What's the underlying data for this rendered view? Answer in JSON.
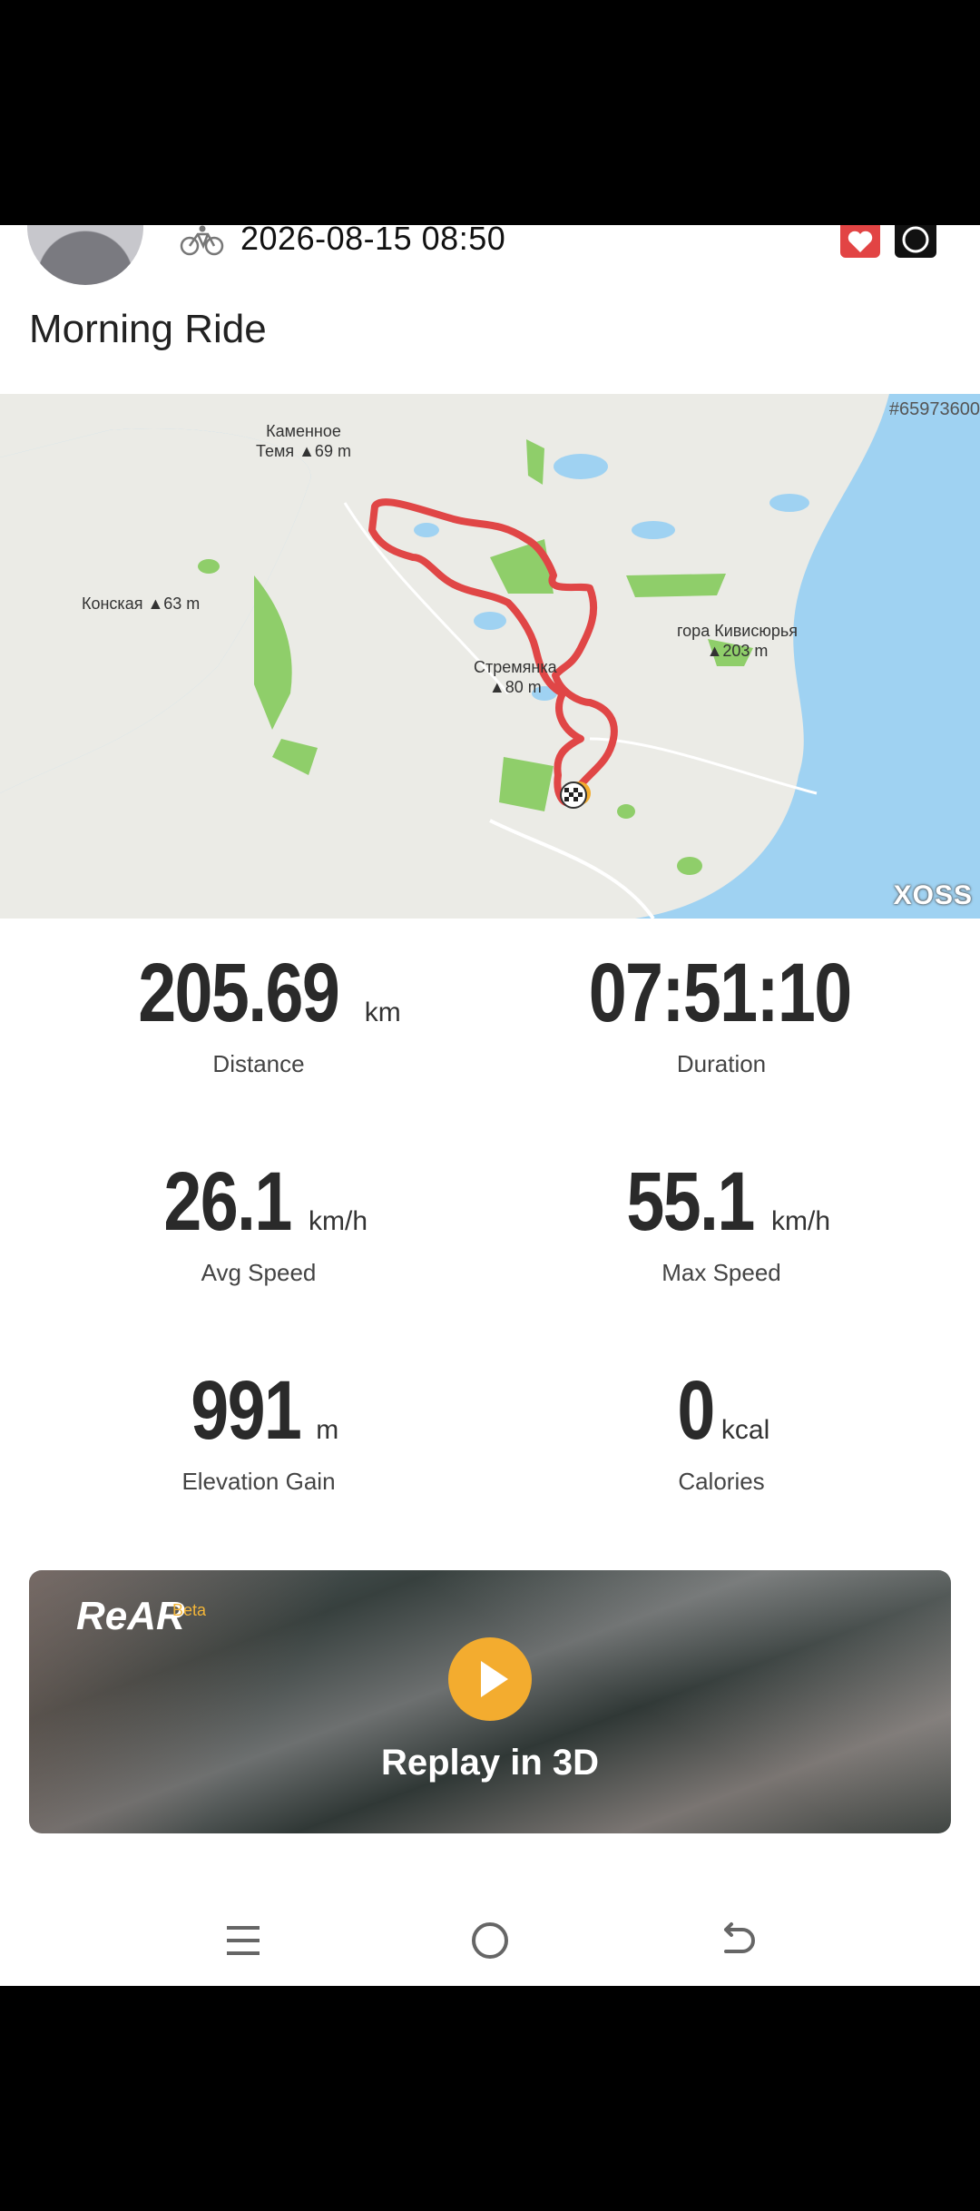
{
  "header": {
    "datetime": "2026-08-15 08:50",
    "title": "Morning Ride"
  },
  "map": {
    "id_label": "#65973600",
    "brand": "XOSS",
    "labels": [
      {
        "id": "kamennoe",
        "text": "Каменное\nТемя ▲69 m"
      },
      {
        "id": "konskaya",
        "text": "Конская ▲63 m"
      },
      {
        "id": "kivisyurya",
        "text": "гора Кивисюрья\n▲203 m"
      },
      {
        "id": "stremyanka",
        "text": "Стремянка\n▲80 m"
      }
    ]
  },
  "stats": [
    {
      "id": "distance",
      "value": "205.69",
      "unit": "km",
      "label": "Distance"
    },
    {
      "id": "duration",
      "value": "07:51:10",
      "unit": "",
      "label": "Duration"
    },
    {
      "id": "avg-speed",
      "value": "26.1",
      "unit": "km/h",
      "label": "Avg Speed"
    },
    {
      "id": "max-speed",
      "value": "55.1",
      "unit": "km/h",
      "label": "Max Speed"
    },
    {
      "id": "elevation-gain",
      "value": "991",
      "unit": "m",
      "label": "Elevation Gain"
    },
    {
      "id": "calories",
      "value": "0",
      "unit": "kcal",
      "label": "Calories"
    }
  ],
  "rear": {
    "logo": "ReAR",
    "badge": "Beta",
    "cta": "Replay in 3D"
  },
  "icons": {
    "bike": "bike-icon",
    "health": "heart-health-icon",
    "ring": "ring-watch-icon",
    "play": "play-icon",
    "nav": [
      "menu-icon",
      "home-icon",
      "back-icon"
    ]
  },
  "colors": {
    "route": "#e04646",
    "accent": "#f3ac2f",
    "water": "#9fd2f2",
    "land": "#ebebe6",
    "park": "#8fce6a"
  }
}
